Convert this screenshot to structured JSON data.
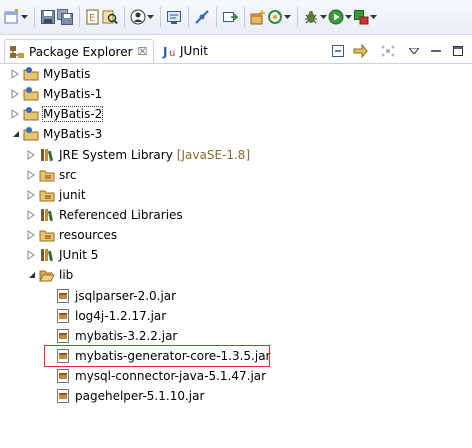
{
  "toolbar": {
    "buttons": [
      {
        "icon": "new-wizard-icon",
        "dropdown": true
      },
      {
        "icon": "save-icon",
        "dropdown": false
      },
      {
        "icon": "save-all-icon",
        "dropdown": false
      },
      {
        "icon": "open-type-icon",
        "dropdown": false
      },
      {
        "icon": "search-icon",
        "dropdown": false
      },
      {
        "icon": "debug-perspective-icon",
        "dropdown": true
      },
      {
        "icon": "console-icon",
        "dropdown": false
      },
      {
        "icon": "skip-breakpoints-icon",
        "dropdown": false
      },
      {
        "icon": "external-tools-icon",
        "dropdown": false
      },
      {
        "icon": "new-package-icon",
        "dropdown": false
      },
      {
        "icon": "refresh-run-icon",
        "dropdown": true
      },
      {
        "icon": "debug-icon",
        "dropdown": true
      },
      {
        "icon": "run-icon",
        "dropdown": true
      },
      {
        "icon": "run-external-icon",
        "dropdown": true
      }
    ]
  },
  "views": {
    "package_explorer": {
      "label": "Package Explorer",
      "close": "☒"
    },
    "junit": {
      "label": "JUnit"
    }
  },
  "tree": {
    "projects": [
      {
        "label": "MyBatis"
      },
      {
        "label": "MyBatis-1"
      },
      {
        "label": "MyBatis-2"
      },
      {
        "label": "MyBatis-3"
      }
    ],
    "children": {
      "jre": {
        "label": "JRE System Library",
        "decoration": "[JavaSE-1.8]"
      },
      "src": {
        "label": "src"
      },
      "junit": {
        "label": "junit"
      },
      "referenced": {
        "label": "Referenced Libraries"
      },
      "resources": {
        "label": "resources"
      },
      "junit5": {
        "label": "JUnit 5"
      },
      "lib": {
        "label": "lib"
      }
    },
    "lib_files": [
      {
        "label": "jsqlparser-2.0.jar"
      },
      {
        "label": "log4j-1.2.17.jar"
      },
      {
        "label": "mybatis-3.2.2.jar"
      },
      {
        "label": "mybatis-generator-core-1.3.5.jar",
        "highlighted": true
      },
      {
        "label": "mysql-connector-java-5.1.47.jar"
      },
      {
        "label": "pagehelper-5.1.10.jar"
      }
    ]
  },
  "colors": {
    "highlight_border": "#e03030",
    "library_decoration": "#8a6a2c"
  }
}
